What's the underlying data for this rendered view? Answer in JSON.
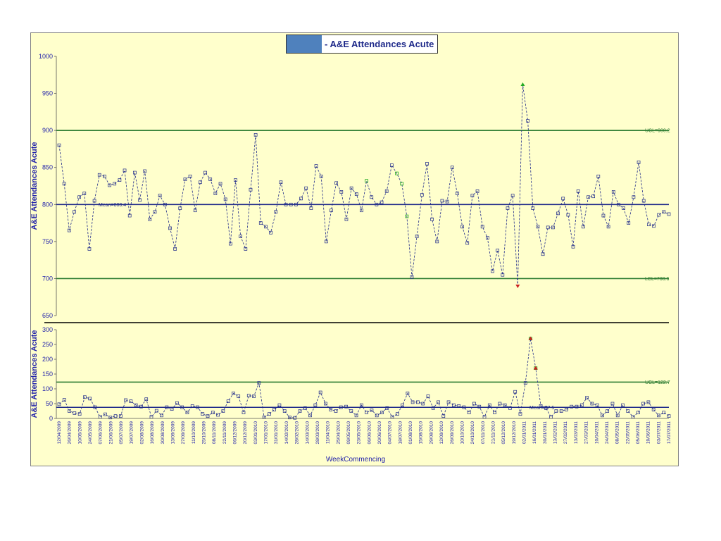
{
  "title": "- A&E Attendances Acute",
  "colors": {
    "background": "#ffffcc",
    "control_line": "#2e7d32",
    "mean_line": "#1f2a8a",
    "series": "#1f2a8a",
    "high_marker": "#22aa22",
    "low_marker": "#cc2222",
    "logo_block": "#4f81bd"
  },
  "chart_data": [
    {
      "type": "line",
      "ylabel": "A&E Attendances Acute",
      "xlabel": "WeekCommencing",
      "ylim": [
        650,
        1000
      ],
      "yticks": [
        "650",
        "700",
        "750",
        "800",
        "850",
        "900",
        "950",
        "1000"
      ],
      "limits": {
        "ucl": 900,
        "ucl_label": "UCL=900.2",
        "mean": 800,
        "mean_label": "Mean=800.4",
        "lcl": 700,
        "lcl_label": "LCL=700.6"
      },
      "values": [
        880,
        828,
        765,
        790,
        810,
        815,
        740,
        805,
        840,
        838,
        826,
        828,
        833,
        846,
        785,
        843,
        806,
        845,
        780,
        790,
        812,
        800,
        768,
        740,
        795,
        834,
        838,
        792,
        830,
        843,
        834,
        815,
        828,
        807,
        747,
        833,
        757,
        740,
        820,
        894,
        775,
        770,
        762,
        790,
        830,
        800,
        800,
        800,
        808,
        822,
        795,
        852,
        838,
        750,
        792,
        829,
        817,
        780,
        822,
        814,
        792,
        832,
        810,
        800,
        803,
        818,
        853,
        842,
        828,
        784,
        702,
        757,
        813,
        855,
        780,
        750,
        805,
        804,
        850,
        815,
        770,
        748,
        812,
        818,
        770,
        755,
        710,
        738,
        705,
        795,
        812,
        690,
        962,
        913,
        795,
        770,
        733,
        769,
        769,
        788,
        808,
        786,
        743,
        818,
        770,
        810,
        811,
        838,
        785,
        770,
        817,
        800,
        795,
        775,
        810,
        857,
        805,
        773,
        771,
        786,
        790,
        787
      ],
      "markers": {
        "high": [
          61,
          67,
          68,
          69,
          92
        ],
        "low": [
          91
        ]
      }
    },
    {
      "type": "line",
      "ylabel": "A&E Attendances Acute",
      "xlabel": "WeekCommencing",
      "ylim": [
        0,
        300
      ],
      "yticks": [
        "0",
        "50",
        "100",
        "150",
        "200",
        "250",
        "300"
      ],
      "limits": {
        "ucl": 122.7,
        "ucl_label": "UCL=122.7",
        "mean": 37.5,
        "mean_label": "Mean=37.5"
      },
      "values": [
        48,
        63,
        25,
        18,
        15,
        72,
        67,
        38,
        5,
        14,
        3,
        8,
        8,
        62,
        58,
        45,
        40,
        65,
        5,
        26,
        10,
        38,
        32,
        52,
        38,
        20,
        42,
        38,
        15,
        8,
        20,
        12,
        25,
        58,
        85,
        75,
        20,
        77,
        75,
        120,
        4,
        15,
        30,
        45,
        25,
        3,
        2,
        25,
        35,
        10,
        45,
        88,
        50,
        30,
        25,
        38,
        40,
        25,
        10,
        45,
        20,
        28,
        10,
        20,
        35,
        5,
        15,
        45,
        85,
        55,
        55,
        50,
        75,
        35,
        55,
        8,
        55,
        45,
        42,
        38,
        20,
        50,
        40,
        5,
        45,
        20,
        50,
        45,
        35,
        90,
        15,
        120,
        270,
        170,
        42,
        35,
        5,
        25,
        25,
        30,
        40,
        40,
        45,
        70,
        50,
        45,
        10,
        25,
        50,
        10,
        45,
        25,
        5,
        20,
        50,
        55,
        30,
        10,
        20,
        8
      ],
      "markers": {
        "high": [
          92,
          93
        ],
        "low": []
      }
    }
  ],
  "x_dates": [
    "12/04/2009",
    "26/04/2009",
    "10/05/2009",
    "24/05/2009",
    "07/06/2009",
    "21/06/2009",
    "05/07/2009",
    "19/07/2009",
    "02/08/2009",
    "16/08/2009",
    "30/08/2009",
    "13/09/2009",
    "27/09/2009",
    "11/10/2009",
    "25/10/2009",
    "08/11/2009",
    "22/11/2009",
    "06/12/2009",
    "20/12/2009",
    "03/01/2010",
    "17/01/2010",
    "31/01/2010",
    "14/02/2010",
    "28/02/2010",
    "14/03/2010",
    "28/03/2010",
    "11/04/2010",
    "25/04/2010",
    "09/05/2010",
    "23/05/2010",
    "06/06/2010",
    "20/06/2010",
    "04/07/2010",
    "18/07/2010",
    "01/08/2010",
    "15/08/2010",
    "29/08/2010",
    "12/09/2010",
    "26/09/2010",
    "10/10/2010",
    "24/10/2010",
    "07/11/2010",
    "21/11/2010",
    "05/12/2010",
    "19/12/2010",
    "02/01/2011",
    "16/01/2011",
    "30/01/2011",
    "13/02/2011",
    "27/02/2011",
    "13/03/2011",
    "27/03/2011",
    "10/04/2011",
    "24/04/2011",
    "08/05/2011",
    "22/05/2011",
    "05/06/2011",
    "19/06/2011",
    "03/07/2011",
    "17/07/2011"
  ]
}
